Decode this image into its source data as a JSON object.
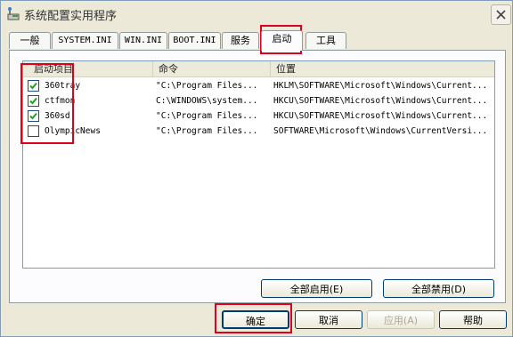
{
  "window": {
    "title": "系统配置实用程序"
  },
  "tabs": [
    {
      "label": "一般"
    },
    {
      "label": "SYSTEM.INI"
    },
    {
      "label": "WIN.INI"
    },
    {
      "label": "BOOT.INI"
    },
    {
      "label": "服务"
    },
    {
      "label": "启动"
    },
    {
      "label": "工具"
    }
  ],
  "active_tab": "启动",
  "table": {
    "headers": [
      "启动项目",
      "命令",
      "位置"
    ],
    "rows": [
      {
        "checked": true,
        "item": "360tray",
        "command": "\"C:\\Program Files...",
        "location": "HKLM\\SOFTWARE\\Microsoft\\Windows\\Current..."
      },
      {
        "checked": true,
        "item": "ctfmon",
        "command": "C:\\WINDOWS\\system...",
        "location": "HKCU\\SOFTWARE\\Microsoft\\Windows\\Current..."
      },
      {
        "checked": true,
        "item": "360sd",
        "command": "\"C:\\Program Files...",
        "location": "HKCU\\SOFTWARE\\Microsoft\\Windows\\Current..."
      },
      {
        "checked": false,
        "item": "OlympicNews",
        "command": "\"C:\\Program Files...",
        "location": "SOFTWARE\\Microsoft\\Windows\\CurrentVersi..."
      }
    ]
  },
  "buttons": {
    "enable_all": "全部启用(E)",
    "disable_all": "全部禁用(D)",
    "ok": "确定",
    "cancel": "取消",
    "apply": "应用(A)",
    "help": "帮助"
  },
  "colors": {
    "highlight": "#e0001b",
    "window_bg": "#ece9d8"
  }
}
